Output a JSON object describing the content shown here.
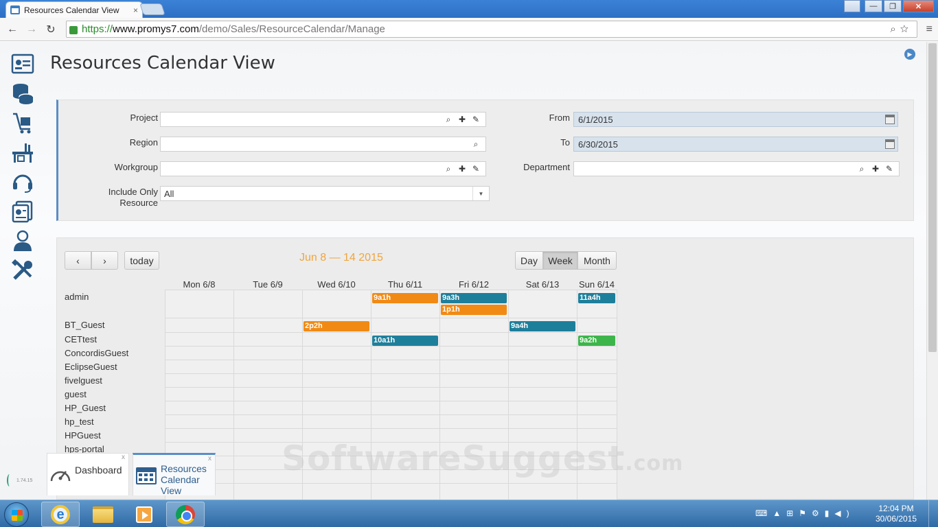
{
  "browser": {
    "tab_title": "Resources Calendar View",
    "tab_close": "×",
    "url_scheme": "https://",
    "url_host": "www.promys7.com",
    "url_path": "/demo/Sales/ResourceCalendar/Manage",
    "win_min": "—",
    "win_max": "❐",
    "win_close": "✕"
  },
  "page": {
    "title": "Resources Calendar View"
  },
  "filters": {
    "project_label": "Project",
    "region_label": "Region",
    "workgroup_label": "Workgroup",
    "include_label_1": "Include Only",
    "include_label_2": "Resource",
    "include_value": "All",
    "from_label": "From",
    "from_value": "6/1/2015",
    "to_label": "To",
    "to_value": "6/30/2015",
    "department_label": "Department"
  },
  "calendar": {
    "prev_label": "‹",
    "next_label": "›",
    "today_label": "today",
    "range_title": "Jun 8 — 14 2015",
    "view_day": "Day",
    "view_week": "Week",
    "view_month": "Month",
    "active_view": "Week",
    "days": [
      "Mon 6/8",
      "Tue 6/9",
      "Wed 6/10",
      "Thu 6/11",
      "Fri 6/12",
      "Sat 6/13",
      "Sun 6/14"
    ],
    "resources": [
      "admin",
      "BT_Guest",
      "CETtest",
      "ConcordisGuest",
      "EclipseGuest",
      "fivelguest",
      "guest",
      "HP_Guest",
      "hp_test",
      "HPGuest",
      "hps-portal"
    ],
    "events": [
      {
        "resource": "admin",
        "day": "Thu 6/11",
        "label": "9a1h",
        "color": "#f18a14"
      },
      {
        "resource": "admin",
        "day": "Fri 6/12",
        "label": "9a3h",
        "color": "#1e7f9b"
      },
      {
        "resource": "admin",
        "day": "Fri 6/12",
        "label": "1p1h",
        "color": "#f18a14"
      },
      {
        "resource": "admin",
        "day": "Sun 6/14",
        "label": "11a4h",
        "color": "#1e7f9b"
      },
      {
        "resource": "BT_Guest",
        "day": "Wed 6/10",
        "label": "2p2h",
        "color": "#f18a14"
      },
      {
        "resource": "BT_Guest",
        "day": "Sat 6/13",
        "label": "9a4h",
        "color": "#1e7f9b"
      },
      {
        "resource": "CETtest",
        "day": "Thu 6/11",
        "label": "10a1h",
        "color": "#1e7f9b"
      },
      {
        "resource": "CETtest",
        "day": "Sun 6/14",
        "label": "9a2h",
        "color": "#3db54a"
      }
    ]
  },
  "watermark": {
    "main": "SoftwareSuggest",
    "suffix": ".com"
  },
  "app_tabs": {
    "version": "1.74.15",
    "dashboard_label": "Dashboard",
    "resources_label_1": "Resources",
    "resources_label_2": "Calendar",
    "resources_label_3": "View",
    "close": "x"
  },
  "taskbar": {
    "time": "12:04 PM",
    "date": "30/06/2015"
  }
}
